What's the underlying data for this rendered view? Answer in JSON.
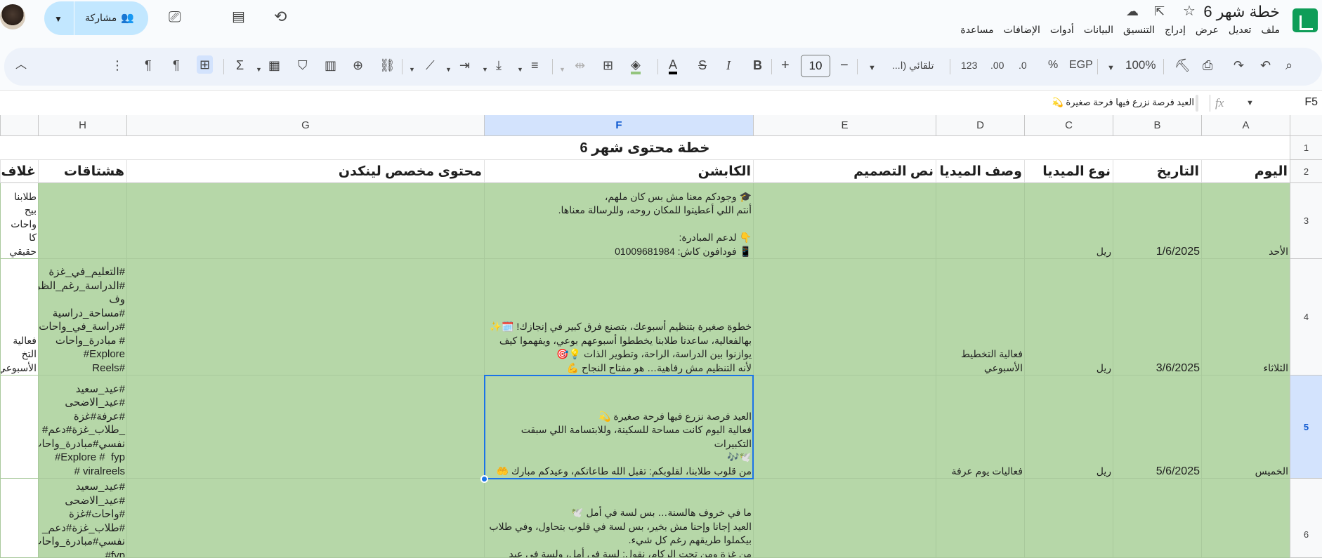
{
  "doc": {
    "title": "خطة شهر 6",
    "menu": [
      "ملف",
      "تعديل",
      "عرض",
      "إدراج",
      "التنسيق",
      "البيانات",
      "أدوات",
      "الإضافات",
      "مساعدة"
    ],
    "share_label": "مشاركة"
  },
  "toolbar": {
    "zoom": "100%",
    "currency": "EGP",
    "percent": "%",
    "dec_decrease": ".0",
    "dec_increase": ".00",
    "number_format": "123",
    "font_name": "تلقائي (ا...",
    "font_size": "10",
    "minus": "−",
    "plus": "+",
    "bold": "B",
    "italic": "I",
    "strike": "S",
    "text_color": "A",
    "sum": "Σ"
  },
  "formula_bar": {
    "cell_ref": "F5",
    "fx": "fx",
    "content": "العيد فرصة نزرع فيها فرحة صغيرة 💫"
  },
  "columns": [
    "A",
    "B",
    "C",
    "D",
    "E",
    "F",
    "G",
    "H"
  ],
  "rows": [
    "1",
    "2",
    "3",
    "4",
    "5",
    "6"
  ],
  "sheet": {
    "title": "خطة محتوى شهر 6",
    "headers": {
      "A": "اليوم",
      "B": "التاريخ",
      "C": "نوع الميديا",
      "D": "وصف الميديا",
      "E": "نص التصميم",
      "F": "الكابشن",
      "G": "محتوى مخصص لينكدن",
      "H": "هشتاقات",
      "I": "غلاف ا"
    },
    "row3": {
      "A": "الأحد",
      "B": "1/6/2025",
      "C": "ريل",
      "D": "",
      "F": "🎓 وجودكم معنا مش بس كان ملهم،\nأنتم اللي أعطيتوا للمكان روحه، وللرسالة معناها.\n\n👇 لدعم المبادرة:\n📱 فودافون كاش: 01009681984",
      "H": "",
      "I": "طلابنا بيح\nواحات كا\nحقيقي"
    },
    "row4": {
      "A": "الثلاثاء",
      "B": "3/6/2025",
      "C": "ريل",
      "D": "فعالية التخطيط\nالأسبوعي",
      "F": "خطوة صغيرة بتنظيم أسبوعك، بتصنع فرق كبير في إنجازك! 🗓️✨\nبهالفعالية، ساعدنا طلابنا يخططوا أسبوعهم بوعي، ويفهموا كيف\nيوازنوا بين الدراسة، الراحة، وتطوير الذات 💡🎯\nلأنه التنظيم مش رفاهية… هو مفتاح النجاح 💪",
      "H": "#التعليم_في_غزة\n#الدراسة_رغم_الظر\nوف\n#مساحة_دراسية\n#دراسة_في_واحات\n# مبادرة_واحات\nExplore#\n#Reels",
      "I": "فعالية التخ\nالأسبوعي"
    },
    "row5": {
      "A": "الخميس",
      "B": "5/6/2025",
      "C": "ريل",
      "D": "فعاليات يوم عرفة",
      "F": "العيد فرصة نزرع فيها فرحة صغيرة 💫\nفعالية اليوم كانت مساحة للسكينة، وللابتسامة اللي سبقت التكبيرات\n🕊️🎶\nمن قلوب طلابنا، لقلوبكم: تقبل الله طاعاتكم، وعيدكم مبارك 🤲",
      "H": "#عيد_سعيد\n#عيد_الاضحى\n#عرفة#غزة\n_طلاب_غزة#دعم#\nنفسي#مبادرة_واحات\nExplore #  fyp#\nviralreels #",
      "I": ""
    },
    "row6": {
      "A": "",
      "F": "ما في خروف هالسنة… بس لسة في أمل 🕊️\nالعيد إجانا وإحنا مش بخير، بس لسة في قلوب بتحاول، وفي طلاب\nبيكملوا طريقهم رغم كل شيء.\nمن غزة ومن تحت الركام، نقول: لسة في أمل، ولسة في عيد وفرحة",
      "H": "#عيد_سعيد\n#عيد_الاضحى\n#واحات#غزة\n#طلاب_غزة#دعم_\nنفسي#مبادرة_واحات\nfyp#"
    }
  }
}
